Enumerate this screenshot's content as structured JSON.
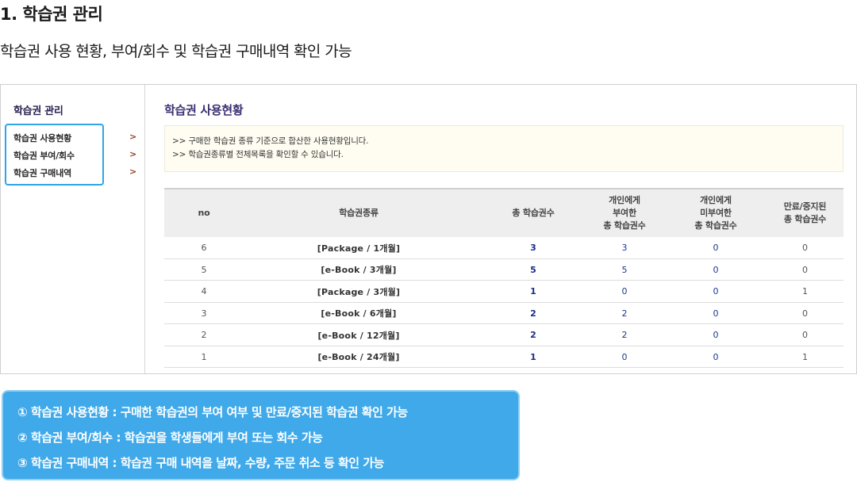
{
  "heading": "1. 학습권 관리",
  "subheading": "학습권 사용 현황, 부여/회수 및 학습권 구매내역 확인 가능",
  "sidebar": {
    "title": "학습권 관리",
    "items": [
      {
        "label": "학습권 사용현황",
        "arrow": ">"
      },
      {
        "label": "학습권 부여/회수",
        "arrow": ">"
      },
      {
        "label": "학습권 구매내역",
        "arrow": ">"
      }
    ],
    "highlight_color": "#2ea6e6"
  },
  "main": {
    "title": "학습권 사용현황",
    "info": [
      ">> 구매한 학습권 종류 기준으로 합산한 사용현황입니다.",
      ">> 학습권종류별 전체목록을 확인할 수 있습니다."
    ],
    "table": {
      "headers": {
        "no": "no",
        "kind": "학습권종류",
        "total": "총 학습권수",
        "given": "개인에게\n부여한\n총 학습권수",
        "notgiven": "개인에게\n미부여한\n총 학습권수",
        "expired": "만료/중지된\n총 학습권수"
      },
      "rows": [
        {
          "no": "6",
          "kind": "[Package / 1개월]",
          "total": "3",
          "given": "3",
          "notgiven": "0",
          "expired": "0"
        },
        {
          "no": "5",
          "kind": "[e-Book / 3개월]",
          "total": "5",
          "given": "5",
          "notgiven": "0",
          "expired": "0"
        },
        {
          "no": "4",
          "kind": "[Package / 3개월]",
          "total": "1",
          "given": "0",
          "notgiven": "0",
          "expired": "1"
        },
        {
          "no": "3",
          "kind": "[e-Book / 6개월]",
          "total": "2",
          "given": "2",
          "notgiven": "0",
          "expired": "0"
        },
        {
          "no": "2",
          "kind": "[e-Book / 12개월]",
          "total": "2",
          "given": "2",
          "notgiven": "0",
          "expired": "0"
        },
        {
          "no": "1",
          "kind": "[e-Book / 24개월]",
          "total": "1",
          "given": "0",
          "notgiven": "0",
          "expired": "1"
        }
      ]
    }
  },
  "callout": {
    "background": "#3fa9ea",
    "lines": [
      "① 학습권 사용현황 : 구매한 학습권의 부여 여부 및 만료/중지된 학습권 확인 가능",
      "② 학습권 부여/회수 : 학습권을 학생들에게 부여 또는 회수 가능",
      "③ 학습권 구매내역 : 학습권 구매 내역을 날짜, 수량, 주문 취소 등 확인 가능"
    ]
  }
}
